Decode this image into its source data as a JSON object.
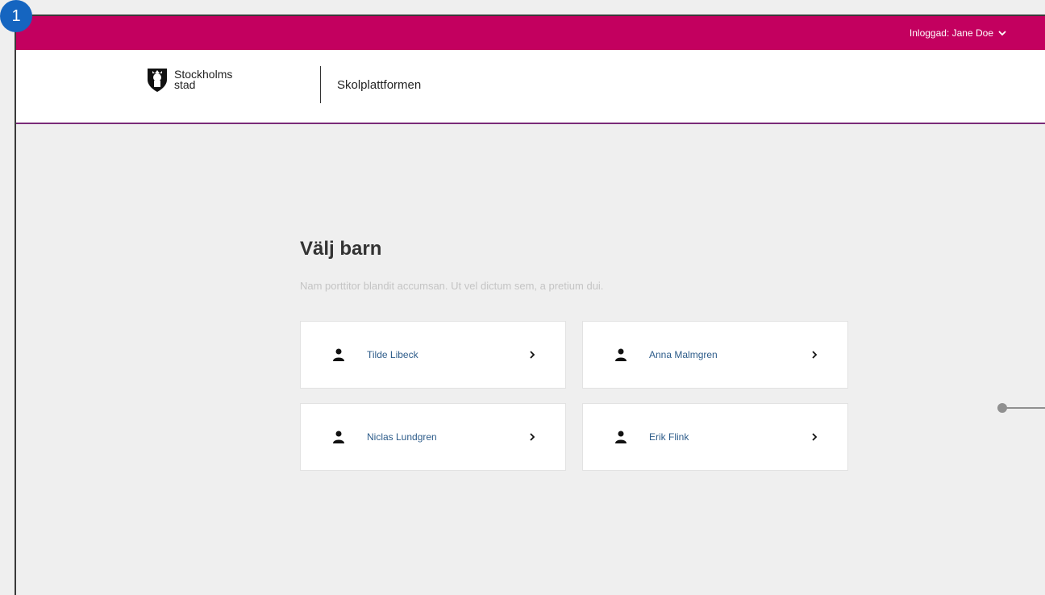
{
  "annotation": {
    "badge_number": "1"
  },
  "topbar": {
    "user_label": "Inloggad: Jane Doe",
    "color": "#c3005f"
  },
  "header": {
    "logo_line1": "Stockholms",
    "logo_line2": "stad",
    "app_name": "Skolplattformen",
    "border_color": "#7a2b78"
  },
  "main": {
    "title": "Välj barn",
    "subtitle": "Nam porttitor blandit accumsan. Ut vel dictum sem, a pretium dui.",
    "children": [
      {
        "name": "Tilde Libeck"
      },
      {
        "name": "Anna Malmgren"
      },
      {
        "name": "Niclas Lundgren"
      },
      {
        "name": "Erik Flink"
      }
    ]
  }
}
